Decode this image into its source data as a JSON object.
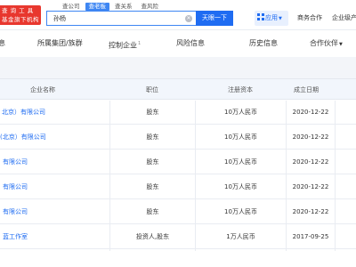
{
  "header": {
    "logo_lines": [
      "查 询 工 具",
      "基金旗下机构"
    ],
    "search_tabs": [
      "查公司",
      "查老板",
      "查关系",
      "查风险"
    ],
    "active_search_tab": 1,
    "search_value": "孙杨",
    "search_button": "天眼一下",
    "apps_label": "应用",
    "links": [
      "商务合作",
      "企业级产"
    ]
  },
  "category_tabs": [
    "息",
    "所属集团/族群",
    "控制企业",
    "风险信息",
    "历史信息",
    "合作伙伴"
  ],
  "table": {
    "headers": [
      "企业名称",
      "职位",
      "注册资本",
      "成立日期"
    ],
    "rows": [
      {
        "name": "北京）有限公司",
        "role": "股东",
        "capital": "10万人民币",
        "date": "2020-12-22"
      },
      {
        "name": "(北京）有限公司",
        "role": "股东",
        "capital": "10万人民币",
        "date": "2020-12-22"
      },
      {
        "name": "有限公司",
        "role": "股东",
        "capital": "10万人民币",
        "date": "2020-12-22"
      },
      {
        "name": "有限公司",
        "role": "股东",
        "capital": "10万人民币",
        "date": "2020-12-22"
      },
      {
        "name": "有限公司",
        "role": "股东",
        "capital": "10万人民币",
        "date": "2020-12-22"
      },
      {
        "name": "蓝工作室",
        "role": "投资人,股东",
        "capital": "1万人民币",
        "date": "2017-09-25"
      }
    ]
  },
  "colors": {
    "brand_red": "#e8372e",
    "accent_blue": "#1f6cf2"
  }
}
